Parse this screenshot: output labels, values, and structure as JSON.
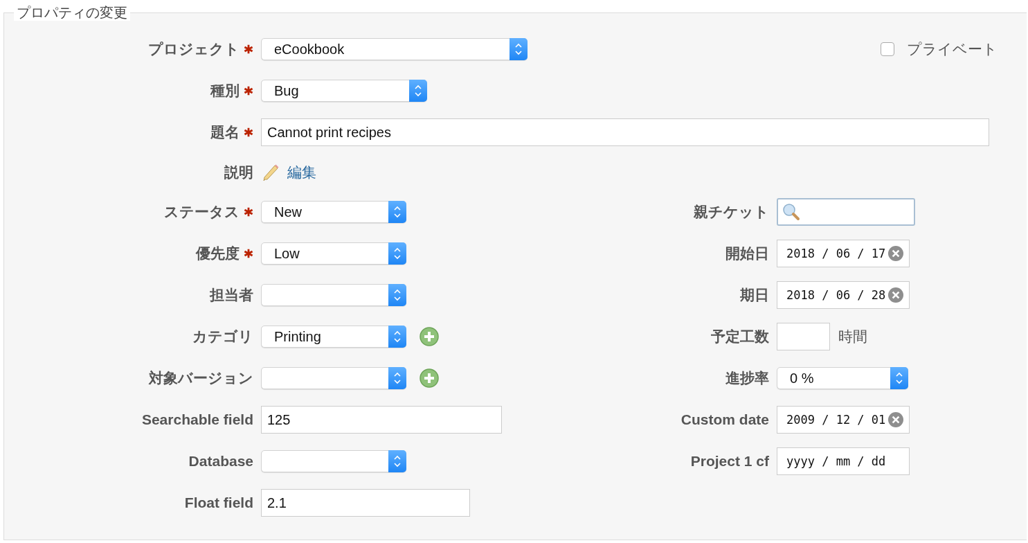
{
  "legend": "プロパティの変更",
  "private": {
    "label": "プライベート",
    "checked": false
  },
  "top_fields": [
    {
      "kind": "select",
      "label": "プロジェクト",
      "required": true,
      "value": "eCookbook"
    },
    {
      "kind": "select",
      "label": "種別",
      "required": true,
      "value": "Bug"
    },
    {
      "kind": "text",
      "label": "題名",
      "required": true,
      "value": "Cannot print recipes"
    },
    {
      "kind": "description",
      "label": "説明",
      "required": false,
      "link": "編集"
    }
  ],
  "left_fields": [
    {
      "kind": "select",
      "label": "ステータス",
      "required": true,
      "value": "New",
      "add": false
    },
    {
      "kind": "select",
      "label": "優先度",
      "required": true,
      "value": "Low",
      "add": false
    },
    {
      "kind": "select",
      "label": "担当者",
      "required": false,
      "add": false
    },
    {
      "kind": "select",
      "label": "カテゴリ",
      "required": false,
      "value": "Printing",
      "add": true
    },
    {
      "kind": "select",
      "label": "対象バージョン",
      "required": false,
      "add": true
    },
    {
      "kind": "text",
      "label": "Searchable field",
      "required": false,
      "value": "125"
    },
    {
      "kind": "select",
      "label": "Database",
      "required": false,
      "add": false
    },
    {
      "kind": "text",
      "label": "Float field",
      "required": false,
      "value": "2.1"
    }
  ],
  "right_fields": [
    {
      "kind": "search",
      "label": "親チケット"
    },
    {
      "kind": "date",
      "label": "開始日",
      "value": "2018 / 06 / 17"
    },
    {
      "kind": "date",
      "label": "期日",
      "value": "2018 / 06 / 28"
    },
    {
      "kind": "hours",
      "label": "予定工数",
      "unit": "時間"
    },
    {
      "kind": "select",
      "label": "進捗率",
      "value": "0 %"
    },
    {
      "kind": "date",
      "label": "Custom date",
      "value": "2009 / 12 / 01"
    },
    {
      "kind": "date",
      "label": "Project 1 cf",
      "placeholder": "yyyy / mm / dd"
    }
  ]
}
